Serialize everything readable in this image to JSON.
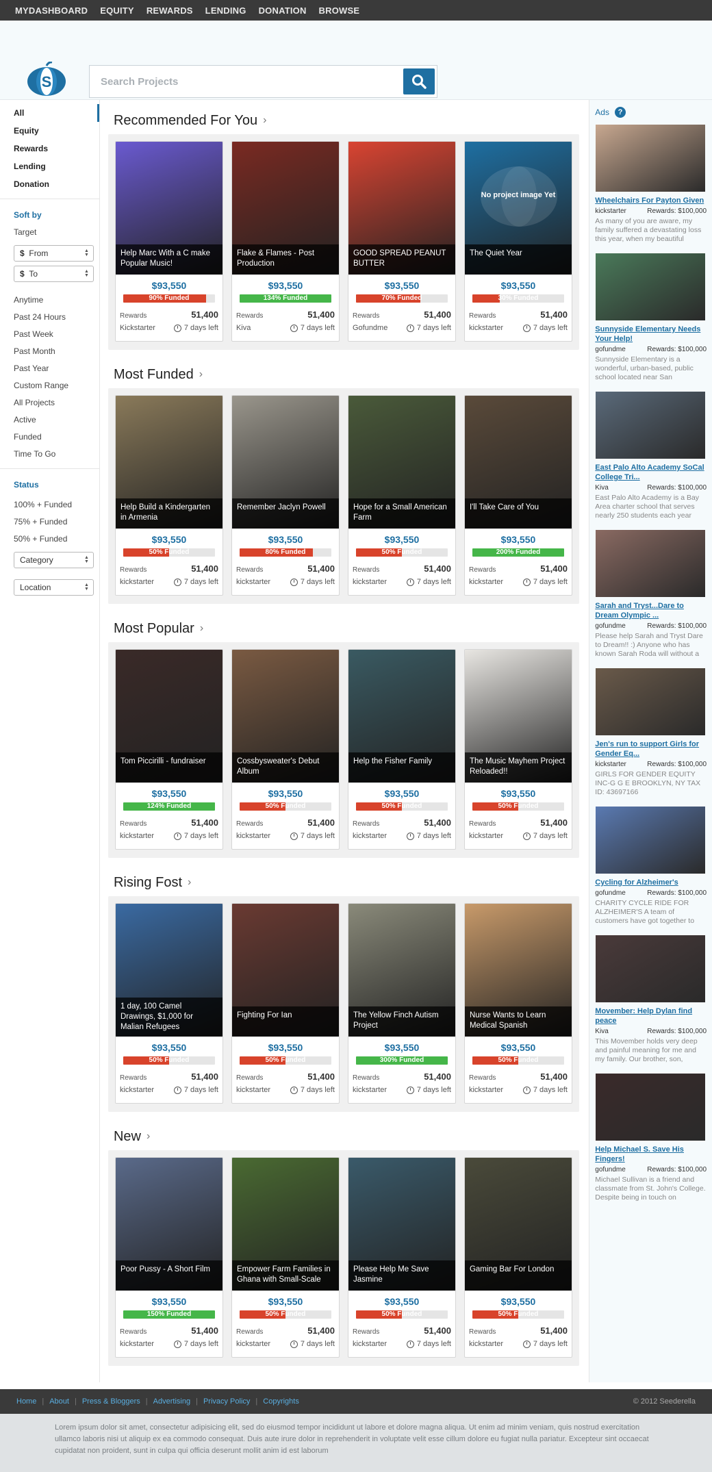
{
  "nav": [
    "MYDASHBOARD",
    "EQUITY",
    "REWARDS",
    "LENDING",
    "DONATION",
    "BROWSE"
  ],
  "search": {
    "placeholder": "Search Projects"
  },
  "sidebar": {
    "categories": [
      "All",
      "Equity",
      "Rewards",
      "Lending",
      "Donation"
    ],
    "sort_heading": "Soft by",
    "target": "Target",
    "from": "From",
    "to": "To",
    "currency": "$",
    "time": [
      "Anytime",
      "Past 24 Hours",
      "Past Week",
      "Past Month",
      "Past Year",
      "Custom Range",
      "All Projects",
      "Active",
      "Funded",
      "Time To Go"
    ],
    "status_heading": "Status",
    "status": [
      "100% + Funded",
      "75% + Funded",
      "50% + Funded"
    ],
    "category": "Category",
    "location": "Location"
  },
  "colors": {
    "red": "#d8432b",
    "green": "#45b649",
    "blue": "#1e6fa2"
  },
  "sections": [
    {
      "title": "Recommended For You",
      "cards": [
        {
          "title": "Help Marc With a C make Popular Music!",
          "amount": "$93,550",
          "funded": "90% Funded",
          "pct": 0.9,
          "color": "red",
          "type": "Rewards",
          "count": "51,400",
          "source": "Kickstarter",
          "time": "7 days left",
          "bg": "#6a5ad0"
        },
        {
          "title": "Flake & Flames - Post Production",
          "amount": "$93,550",
          "funded": "134% Funded",
          "pct": 1.0,
          "color": "green",
          "type": "Rewards",
          "count": "51,400",
          "source": "Kiva",
          "time": "7 days left",
          "bg": "#7a2a22"
        },
        {
          "title": "GOOD SPREAD PEANUT BUTTER",
          "amount": "$93,550",
          "funded": "70% Funded",
          "pct": 0.7,
          "color": "red",
          "type": "Rewards",
          "count": "51,400",
          "source": "Gofundme",
          "time": "7 days left",
          "bg": "#d94432"
        },
        {
          "title": "The Quiet Year",
          "amount": "$93,550",
          "funded": "30% Funded",
          "pct": 0.3,
          "color": "red",
          "type": "Rewards",
          "count": "51,400",
          "source": "kickstarter",
          "time": "7 days left",
          "bg": "#1e6fa2",
          "noimg": "No project image Yet"
        }
      ]
    },
    {
      "title": "Most Funded",
      "cards": [
        {
          "title": "Help Build a Kindergarten in Armenia",
          "amount": "$93,550",
          "funded": "50% Funded",
          "pct": 0.5,
          "color": "red",
          "type": "Rewards",
          "count": "51,400",
          "source": "kickstarter",
          "time": "7 days left",
          "bg": "#8a7a5a"
        },
        {
          "title": "Remember Jaclyn Powell",
          "amount": "$93,550",
          "funded": "80% Funded",
          "pct": 0.8,
          "color": "red",
          "type": "Rewards",
          "count": "51,400",
          "source": "kickstarter",
          "time": "7 days left",
          "bg": "#9a968c"
        },
        {
          "title": "Hope for a Small American Farm",
          "amount": "$93,550",
          "funded": "50% Funded",
          "pct": 0.5,
          "color": "red",
          "type": "Rewards",
          "count": "51,400",
          "source": "kickstarter",
          "time": "7 days left",
          "bg": "#4a5a3a"
        },
        {
          "title": "I'll Take Care of You",
          "amount": "$93,550",
          "funded": "200% Funded",
          "pct": 1.0,
          "color": "green",
          "type": "Rewards",
          "count": "51,400",
          "source": "kickstarter",
          "time": "7 days left",
          "bg": "#5a4a3a"
        }
      ]
    },
    {
      "title": "Most Popular",
      "cards": [
        {
          "title": "Tom Piccirilli - fundraiser",
          "amount": "$93,550",
          "funded": "124% Funded",
          "pct": 1.0,
          "color": "green",
          "type": "Rewards",
          "count": "51,400",
          "source": "kickstarter",
          "time": "7 days left",
          "bg": "#3a2a28"
        },
        {
          "title": "Cossbysweater's Debut Album",
          "amount": "$93,550",
          "funded": "50% Funded",
          "pct": 0.5,
          "color": "red",
          "type": "Rewards",
          "count": "51,400",
          "source": "kickstarter",
          "time": "7 days left",
          "bg": "#7a5a42"
        },
        {
          "title": "Help the Fisher Family",
          "amount": "$93,550",
          "funded": "50% Funded",
          "pct": 0.5,
          "color": "red",
          "type": "Rewards",
          "count": "51,400",
          "source": "kickstarter",
          "time": "7 days left",
          "bg": "#3a5a62"
        },
        {
          "title": "The Music Mayhem Project Reloaded!!",
          "amount": "$93,550",
          "funded": "50% Funded",
          "pct": 0.5,
          "color": "red",
          "type": "Rewards",
          "count": "51,400",
          "source": "kickstarter",
          "time": "7 days left",
          "bg": "#e8e6e2"
        }
      ]
    },
    {
      "title": "Rising Fost",
      "cards": [
        {
          "title": "1 day, 100 Camel Drawings, $1,000 for Malian Refugees",
          "amount": "$93,550",
          "funded": "50% Funded",
          "pct": 0.5,
          "color": "red",
          "type": "Rewards",
          "count": "51,400",
          "source": "kickstarter",
          "time": "7 days left",
          "bg": "#3a6aa2"
        },
        {
          "title": "Fighting For Ian",
          "amount": "$93,550",
          "funded": "50% Funded",
          "pct": 0.5,
          "color": "red",
          "type": "Rewards",
          "count": "51,400",
          "source": "kickstarter",
          "time": "7 days left",
          "bg": "#6a3a32"
        },
        {
          "title": "The Yellow Finch Autism Project",
          "amount": "$93,550",
          "funded": "300% Funded",
          "pct": 1.0,
          "color": "green",
          "type": "Rewards",
          "count": "51,400",
          "source": "kickstarter",
          "time": "7 days left",
          "bg": "#8a8a7a"
        },
        {
          "title": "Nurse Wants to Learn Medical Spanish",
          "amount": "$93,550",
          "funded": "50% Funded",
          "pct": 0.5,
          "color": "red",
          "type": "Rewards",
          "count": "51,400",
          "source": "kickstarter",
          "time": "7 days left",
          "bg": "#c89a6a"
        }
      ]
    },
    {
      "title": "New",
      "cards": [
        {
          "title": "Poor Pussy - A Short Film",
          "amount": "$93,550",
          "funded": "150% Funded",
          "pct": 1.0,
          "color": "green",
          "type": "Rewards",
          "count": "51,400",
          "source": "kickstarter",
          "time": "7 days left",
          "bg": "#5a6a8a"
        },
        {
          "title": "Empower Farm Families in Ghana with Small-Scale",
          "amount": "$93,550",
          "funded": "50% Funded",
          "pct": 0.5,
          "color": "red",
          "type": "Rewards",
          "count": "51,400",
          "source": "kickstarter",
          "time": "7 days left",
          "bg": "#4a6a32"
        },
        {
          "title": "Please Help Me Save Jasmine",
          "amount": "$93,550",
          "funded": "50% Funded",
          "pct": 0.5,
          "color": "red",
          "type": "Rewards",
          "count": "51,400",
          "source": "kickstarter",
          "time": "7 days left",
          "bg": "#3a5a6a"
        },
        {
          "title": "Gaming Bar For London",
          "amount": "$93,550",
          "funded": "50% Funded",
          "pct": 0.5,
          "color": "red",
          "type": "Rewards",
          "count": "51,400",
          "source": "kickstarter",
          "time": "7 days left",
          "bg": "#4a4a3a"
        }
      ]
    }
  ],
  "ads": {
    "heading": "Ads",
    "help": "?",
    "items": [
      {
        "title": "Wheelchairs For Payton Given",
        "source": "kickstarter",
        "rewards": "Rewards: $100,000",
        "desc": "As many of you are aware, my family suffered a devastating loss this year, when my beautiful",
        "bg": "#c8a890"
      },
      {
        "title": "Sunnyside Elementary Needs Your Help!",
        "source": "gofundme",
        "rewards": "Rewards: $100,000",
        "desc": "Sunnyside Elementary is a wonderful, urban-based, public school located near San",
        "bg": "#4a7a5a"
      },
      {
        "title": "East Palo Alto Academy SoCal College Tri...",
        "source": "Kiva",
        "rewards": "Rewards: $100,000",
        "desc": "East Palo Alto Academy is a Bay Area charter school that serves nearly 250 students each year",
        "bg": "#5a6a7a"
      },
      {
        "title": "Sarah and Tryst...Dare to Dream Olympic ...",
        "source": "gofundme",
        "rewards": "Rewards: $100,000",
        "desc": "Please help Sarah and Tryst Dare to Dream!! :) Anyone who has known Sarah Roda will without a",
        "bg": "#8a6a62"
      },
      {
        "title": "Jen's run to support Girls for Gender Eq...",
        "source": "kickstarter",
        "rewards": "Rewards: $100,000",
        "desc": "GIRLS FOR GENDER EQUITY INC-G G E BROOKLYN, NY TAX ID: 43697166",
        "bg": "#6a5a4a"
      },
      {
        "title": "Cycling for Alzheimer's",
        "source": "gofundme",
        "rewards": "Rewards: $100,000",
        "desc": "CHARITY CYCLE RIDE FOR ALZHEIMER'S A team of customers have got together to",
        "bg": "#5a7ab2"
      },
      {
        "title": "Movember: Help Dylan find peace",
        "source": "Kiva",
        "rewards": "Rewards: $100,000",
        "desc": "This Movember holds very deep and painful meaning for me and my family. Our brother, son,",
        "bg": "#4a3a3a"
      },
      {
        "title": "Help Michael S. Save His Fingers!",
        "source": "gofundme",
        "rewards": "Rewards: $100,000",
        "desc": "Michael Sullivan is a friend and classmate from St. John's College. Despite being in touch on",
        "bg": "#3a2a2a"
      }
    ]
  },
  "footer": {
    "links": [
      "Home",
      "About",
      "Press & Bloggers",
      "Advertising",
      "Privacy Policy",
      "Copyrights"
    ],
    "copyright": "© 2012 Seederella"
  },
  "lorem": "Lorem ipsum dolor sit amet, consectetur adipisicing elit, sed do eiusmod tempor incididunt ut labore et dolore magna aliqua. Ut enim ad minim veniam, quis nostrud exercitation ullamco laboris nisi ut aliquip ex ea commodo consequat. Duis aute irure dolor in reprehenderit in voluptate velit esse cillum dolore eu fugiat nulla pariatur. Excepteur sint occaecat cupidatat non proident, sunt in culpa qui officia deserunt mollit anim id est laborum"
}
